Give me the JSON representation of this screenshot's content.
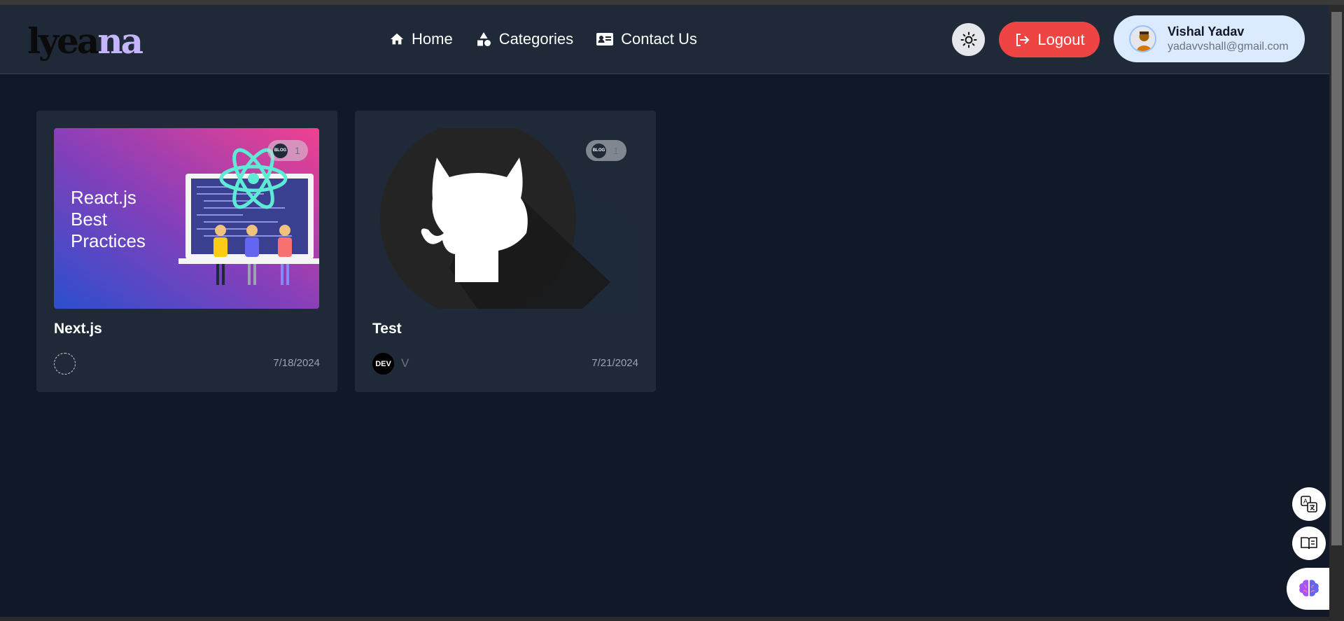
{
  "brand": {
    "logo_part1": "lyea",
    "logo_part2": "na"
  },
  "nav": {
    "items": [
      {
        "label": "Home",
        "icon": "home-icon"
      },
      {
        "label": "Categories",
        "icon": "shapes-icon"
      },
      {
        "label": "Contact Us",
        "icon": "contact-card-icon"
      }
    ]
  },
  "header": {
    "theme_icon": "sun-icon",
    "logout_label": "Logout",
    "user": {
      "name": "Vishal Yadav",
      "email": "yadavvshall@gmail.com"
    }
  },
  "posts": [
    {
      "title": "Next.js",
      "image_text": [
        "React.js",
        "Best",
        "Practices"
      ],
      "badge_label": "BLOG",
      "badge_count": "1",
      "author": "",
      "date": "7/18/2024"
    },
    {
      "title": "Test",
      "image_text": [],
      "badge_label": "BLOG",
      "badge_count": "1",
      "author_logo": "DEV",
      "author": "V",
      "date": "7/21/2024"
    }
  ],
  "floating_tools": [
    "translate-icon",
    "reader-icon",
    "brain-icon"
  ],
  "colors": {
    "background": "#111827",
    "card": "#1f2937",
    "logout": "#ef4444",
    "accent": "#c4b5fd"
  }
}
